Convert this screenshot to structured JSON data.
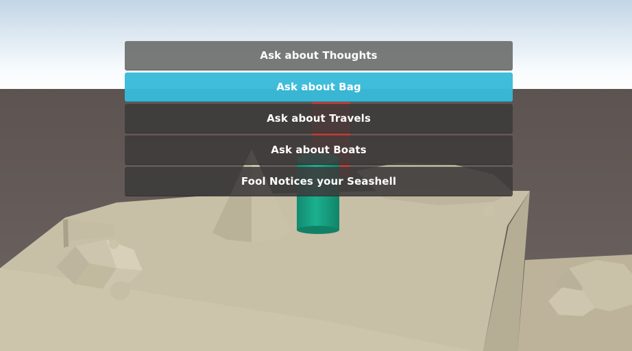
{
  "scene": {
    "sky_top": "#c3d5e6",
    "sky_bottom": "#ffffff",
    "ground_color": "#5f5754",
    "platform_top": "#c7bfa6",
    "platform_side": "#bab298",
    "platform_front": "#d5cdb2",
    "cylinder_color": "#19a285",
    "cube_color": "#c23c34",
    "rock_color": "#cdc5ad"
  },
  "dialogue": {
    "selected_index": 1,
    "options": [
      {
        "label": "Ask about Thoughts"
      },
      {
        "label": "Ask about Bag"
      },
      {
        "label": "Ask about Travels"
      },
      {
        "label": "Ask about Boats"
      },
      {
        "label": "Fool Notices your Seashell"
      }
    ]
  }
}
